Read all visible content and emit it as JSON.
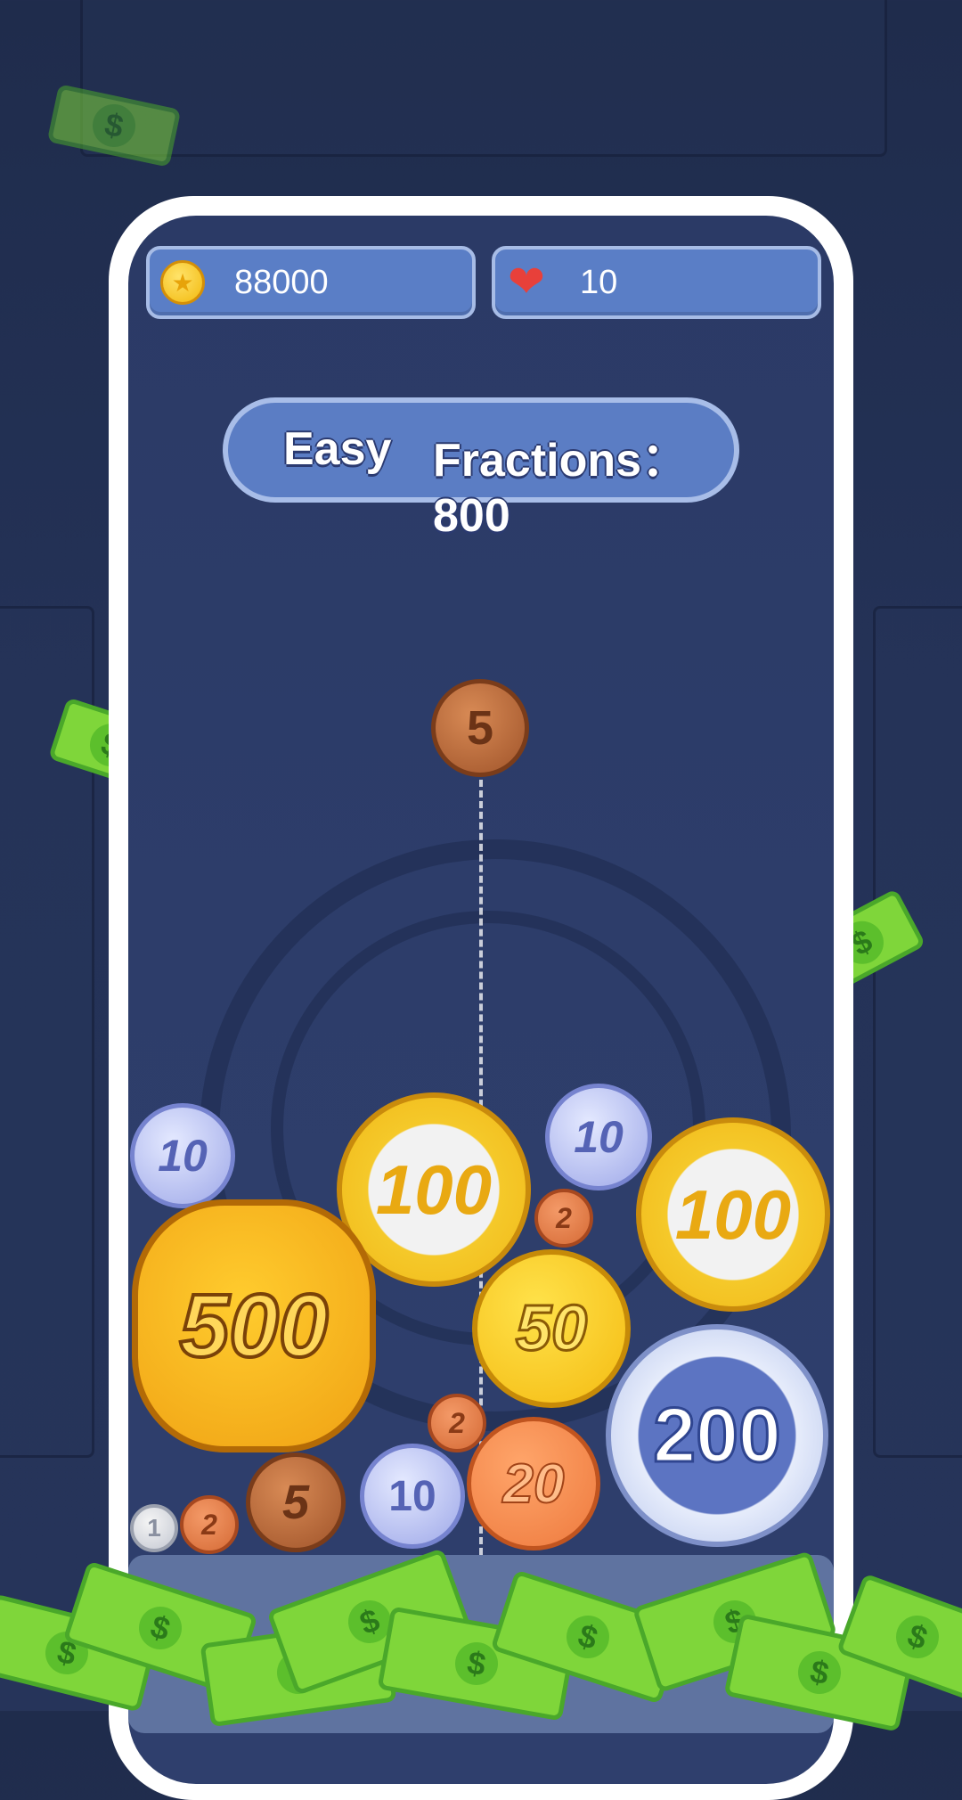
{
  "hud": {
    "coins_value": "88000",
    "lives_value": "10",
    "coin_icon": "gold-star-coin-icon",
    "heart_icon": "heart-icon"
  },
  "level": {
    "difficulty": "Easy",
    "target_label": "Fractions： 800"
  },
  "drop_coin": {
    "value": "5",
    "icon": "bronze-coin"
  },
  "coins": [
    {
      "value": "10",
      "type": "silver-blue"
    },
    {
      "value": "100",
      "type": "silver-gold"
    },
    {
      "value": "10",
      "type": "silver-blue"
    },
    {
      "value": "100",
      "type": "silver-gold"
    },
    {
      "value": "2",
      "type": "copper"
    },
    {
      "value": "500",
      "type": "gold-octagon"
    },
    {
      "value": "50",
      "type": "gold"
    },
    {
      "value": "200",
      "type": "blue-diamond"
    },
    {
      "value": "2",
      "type": "copper"
    },
    {
      "value": "20",
      "type": "orange"
    },
    {
      "value": "1",
      "type": "silver"
    },
    {
      "value": "2",
      "type": "copper"
    },
    {
      "value": "5",
      "type": "bronze"
    },
    {
      "value": "10",
      "type": "silver-blue"
    }
  ],
  "colors": {
    "background": "#243257",
    "hud_fill": "#5a7ec6",
    "bill_green": "#7fd63a"
  }
}
